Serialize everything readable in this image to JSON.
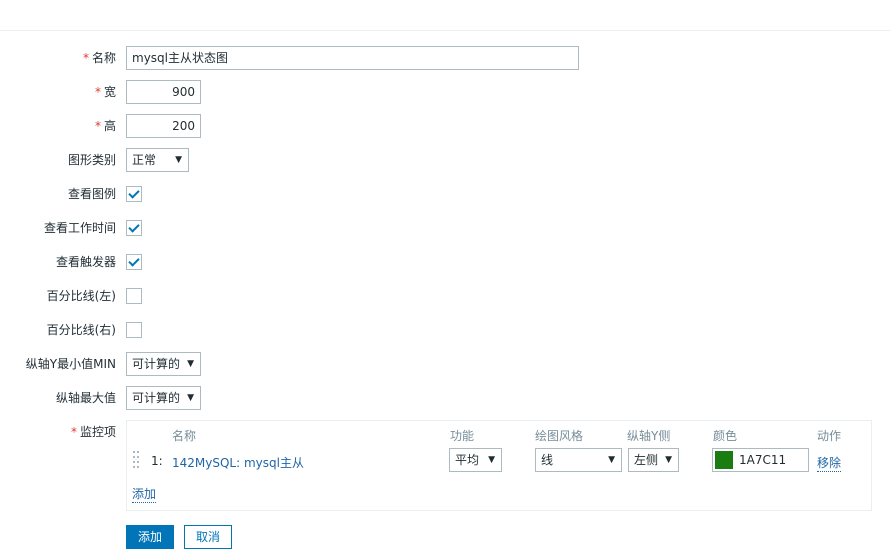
{
  "form": {
    "required_mark": "*",
    "name": {
      "label": "名称",
      "value": "mysql主从状态图"
    },
    "width": {
      "label": "宽",
      "value": "900"
    },
    "height": {
      "label": "高",
      "value": "200"
    },
    "graph_type": {
      "label": "图形类别",
      "value": "正常"
    },
    "show_legend": {
      "label": "查看图例",
      "checked": true
    },
    "show_working_time": {
      "label": "查看工作时间",
      "checked": true
    },
    "show_triggers": {
      "label": "查看触发器",
      "checked": true
    },
    "percentile_left": {
      "label": "百分比线(左)",
      "checked": false
    },
    "percentile_right": {
      "label": "百分比线(右)",
      "checked": false
    },
    "y_min": {
      "label": "纵轴Y最小值MIN",
      "value": "可计算的"
    },
    "y_max": {
      "label": "纵轴最大值",
      "value": "可计算的"
    },
    "items": {
      "label": "监控项",
      "headers": {
        "name": "名称",
        "function": "功能",
        "draw_style": "绘图风格",
        "y_axis_side": "纵轴Y侧",
        "color": "颜色",
        "action": "动作"
      },
      "rows": [
        {
          "index": "1:",
          "name": "142MySQL: mysql主从",
          "function": "平均",
          "draw_style": "线",
          "y_axis_side": "左侧",
          "color_hex": "#1A7C11",
          "color_text": "1A7C11",
          "action": "移除"
        }
      ],
      "add_link": "添加"
    }
  },
  "buttons": {
    "add": "添加",
    "cancel": "取消"
  },
  "icons": {
    "dropdown": "▼",
    "checkbox_tick": "checkmark-icon",
    "drag_handle": "drag-handle-icon"
  },
  "colors": {
    "accent": "#0275b8",
    "link": "#1f65a6",
    "required": "#e33734",
    "item_color": "#1A7C11"
  }
}
